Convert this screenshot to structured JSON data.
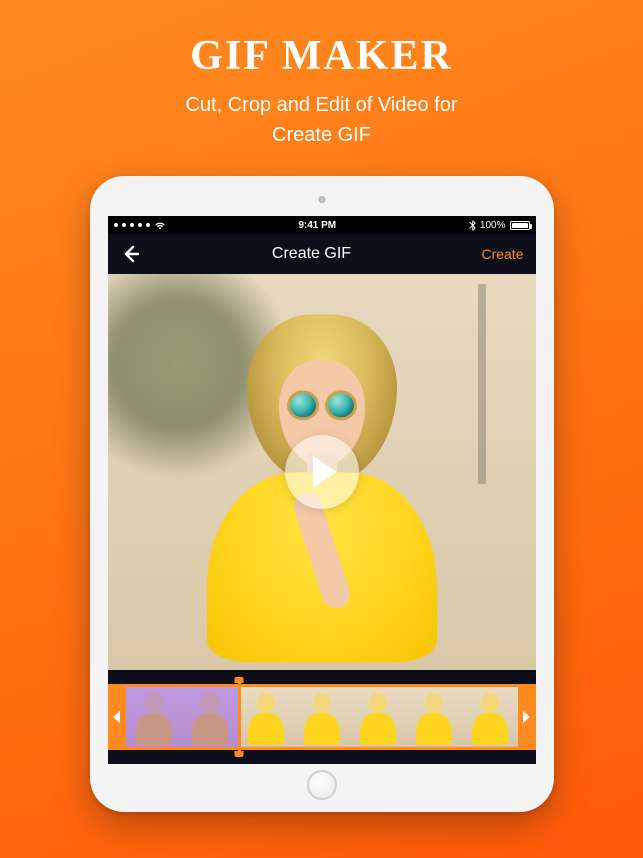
{
  "hero": {
    "title": "GIF MAKER",
    "subtitle_line1": "Cut, Crop and Edit of Video for",
    "subtitle_line2": "Create GIF"
  },
  "statusbar": {
    "time": "9:41 PM",
    "battery_pct": "100%"
  },
  "app": {
    "title": "Create GIF",
    "action_label": "Create"
  },
  "icons": {
    "back": "arrow-left",
    "play": "play",
    "wifi": "wifi",
    "bluetooth": "bluetooth",
    "battery": "battery",
    "handle_left": "chevron-left",
    "handle_right": "chevron-right"
  },
  "timeline": {
    "frame_count": 7,
    "selected_start_index": 0,
    "selected_end_index": 1,
    "playhead_index": 2
  },
  "colors": {
    "accent": "#ff8a1f",
    "screen_bg": "#0c0f1a"
  }
}
